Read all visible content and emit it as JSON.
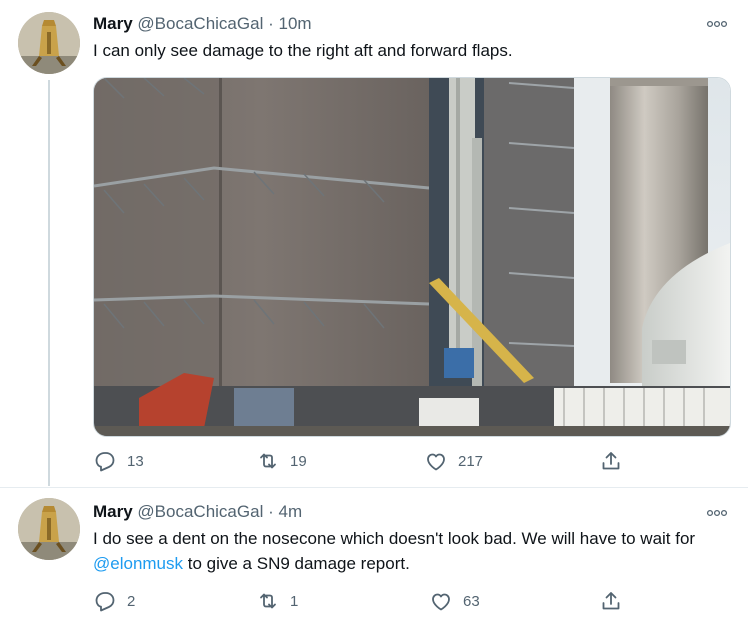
{
  "tweets": [
    {
      "author_name": "Mary",
      "handle": "@BocaChicaGal",
      "separator": "·",
      "time": "10m",
      "text": "I can only see damage to the right aft and forward flaps.",
      "replies": "13",
      "retweets": "19",
      "likes": "217"
    },
    {
      "author_name": "Mary",
      "handle": "@BocaChicaGal",
      "separator": "·",
      "time": "4m",
      "text_before": "I do see a dent on the nosecone which doesn't look bad. We will have to wait for ",
      "mention": "@elonmusk",
      "text_after": " to give a SN9 damage report.",
      "replies": "2",
      "retweets": "1",
      "likes": "63"
    }
  ],
  "icons": {
    "more": "more-icon",
    "reply": "reply-icon",
    "retweet": "retweet-icon",
    "like": "like-icon",
    "share": "share-icon"
  },
  "colors": {
    "text": "#0f1419",
    "secondary": "#536471",
    "mention": "#1d9bf0",
    "thread_line": "#cfd9de"
  }
}
